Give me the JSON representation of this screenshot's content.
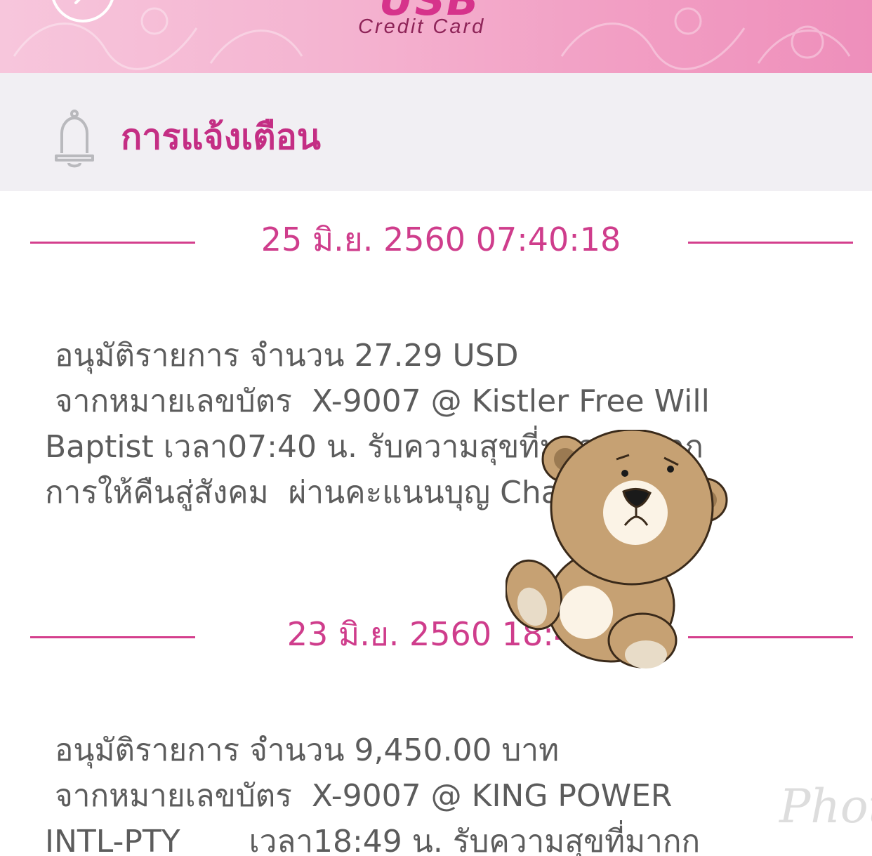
{
  "header": {
    "brand_sub": "Credit Card",
    "brand_logo": "USB",
    "back_icon": "chevron-left-icon"
  },
  "notifications": {
    "title": "การแจ้งเตือน",
    "icon": "bell-icon",
    "items": [
      {
        "date": "25 มิ.ย. 2560 07:40:18",
        "lines": [
          "อนุมัติรายการ จำนวน 27.29 USD",
          "จากหมายเลขบัตร  X-9007 @ Kistler Free Will",
          "Baptist เวลา07:40 น. รับความสุขที่มากกว่าจาก",
          "การให้คืนสู่สังคม  ผ่านคะแนนบุญ Charit..."
        ]
      },
      {
        "date": "23 มิ.ย. 2560 18:49",
        "lines": [
          "อนุมัติรายการ จำนวน 9,450.00 บาท",
          "จากหมายเลขบัตร  X-9007 @ KING POWER",
          "INTL-PTY       เวลา18:49 น. รับความสุขที่มากก"
        ]
      }
    ]
  },
  "sticker": {
    "icon": "teddy-bear-sticker"
  },
  "watermark": "Phot",
  "colors": {
    "accent": "#d43f8d",
    "header_bg": "#f1eff3",
    "body_text": "#5c5c5c"
  }
}
